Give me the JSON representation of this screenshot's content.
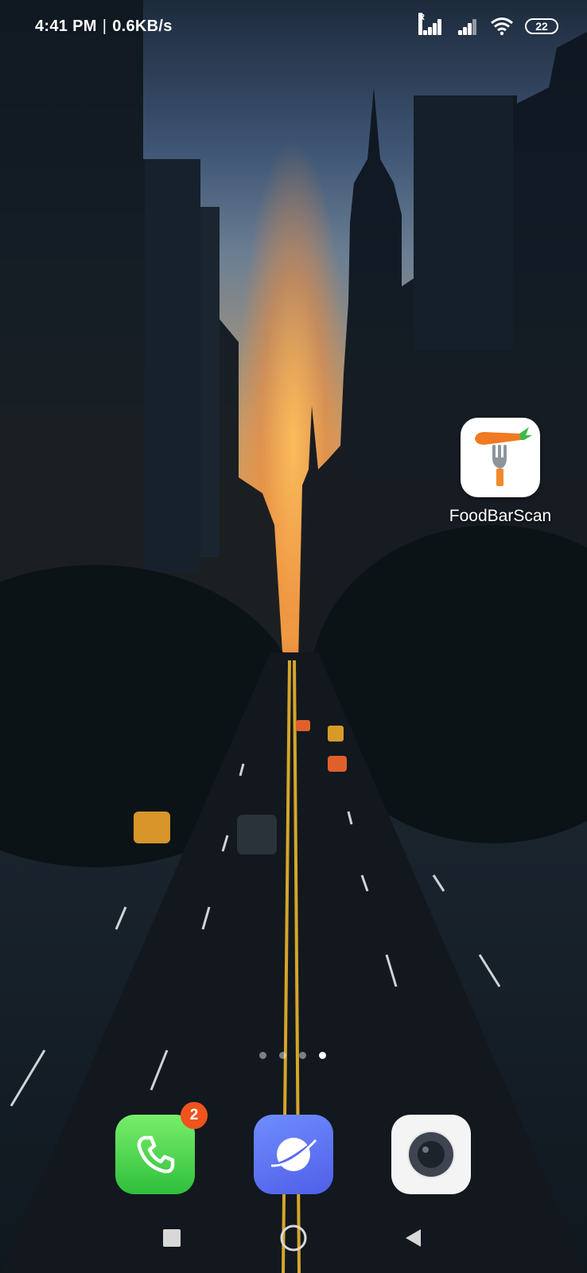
{
  "status_bar": {
    "time": "4:41 PM",
    "separator": "|",
    "network_speed": "0.6KB/s",
    "signal_1_roaming": "R",
    "battery_level": "22",
    "icons": [
      "signal-icon",
      "signal-icon",
      "wifi-icon",
      "battery-icon"
    ]
  },
  "home": {
    "apps": [
      {
        "label": "FoodBarScan",
        "icon": "fork-carrot-icon"
      }
    ],
    "pages": {
      "count": 4,
      "active_index": 3
    }
  },
  "dock": {
    "apps": [
      {
        "name": "phone",
        "icon": "phone-icon",
        "badge": "2",
        "color": "#3fcf45"
      },
      {
        "name": "browser",
        "icon": "browser-icon",
        "color": "#5b6cf2"
      },
      {
        "name": "camera",
        "icon": "camera-icon",
        "color": "#f4f4f4"
      }
    ]
  },
  "navbar": {
    "buttons": [
      "recent-apps-button",
      "home-button",
      "back-button"
    ]
  }
}
